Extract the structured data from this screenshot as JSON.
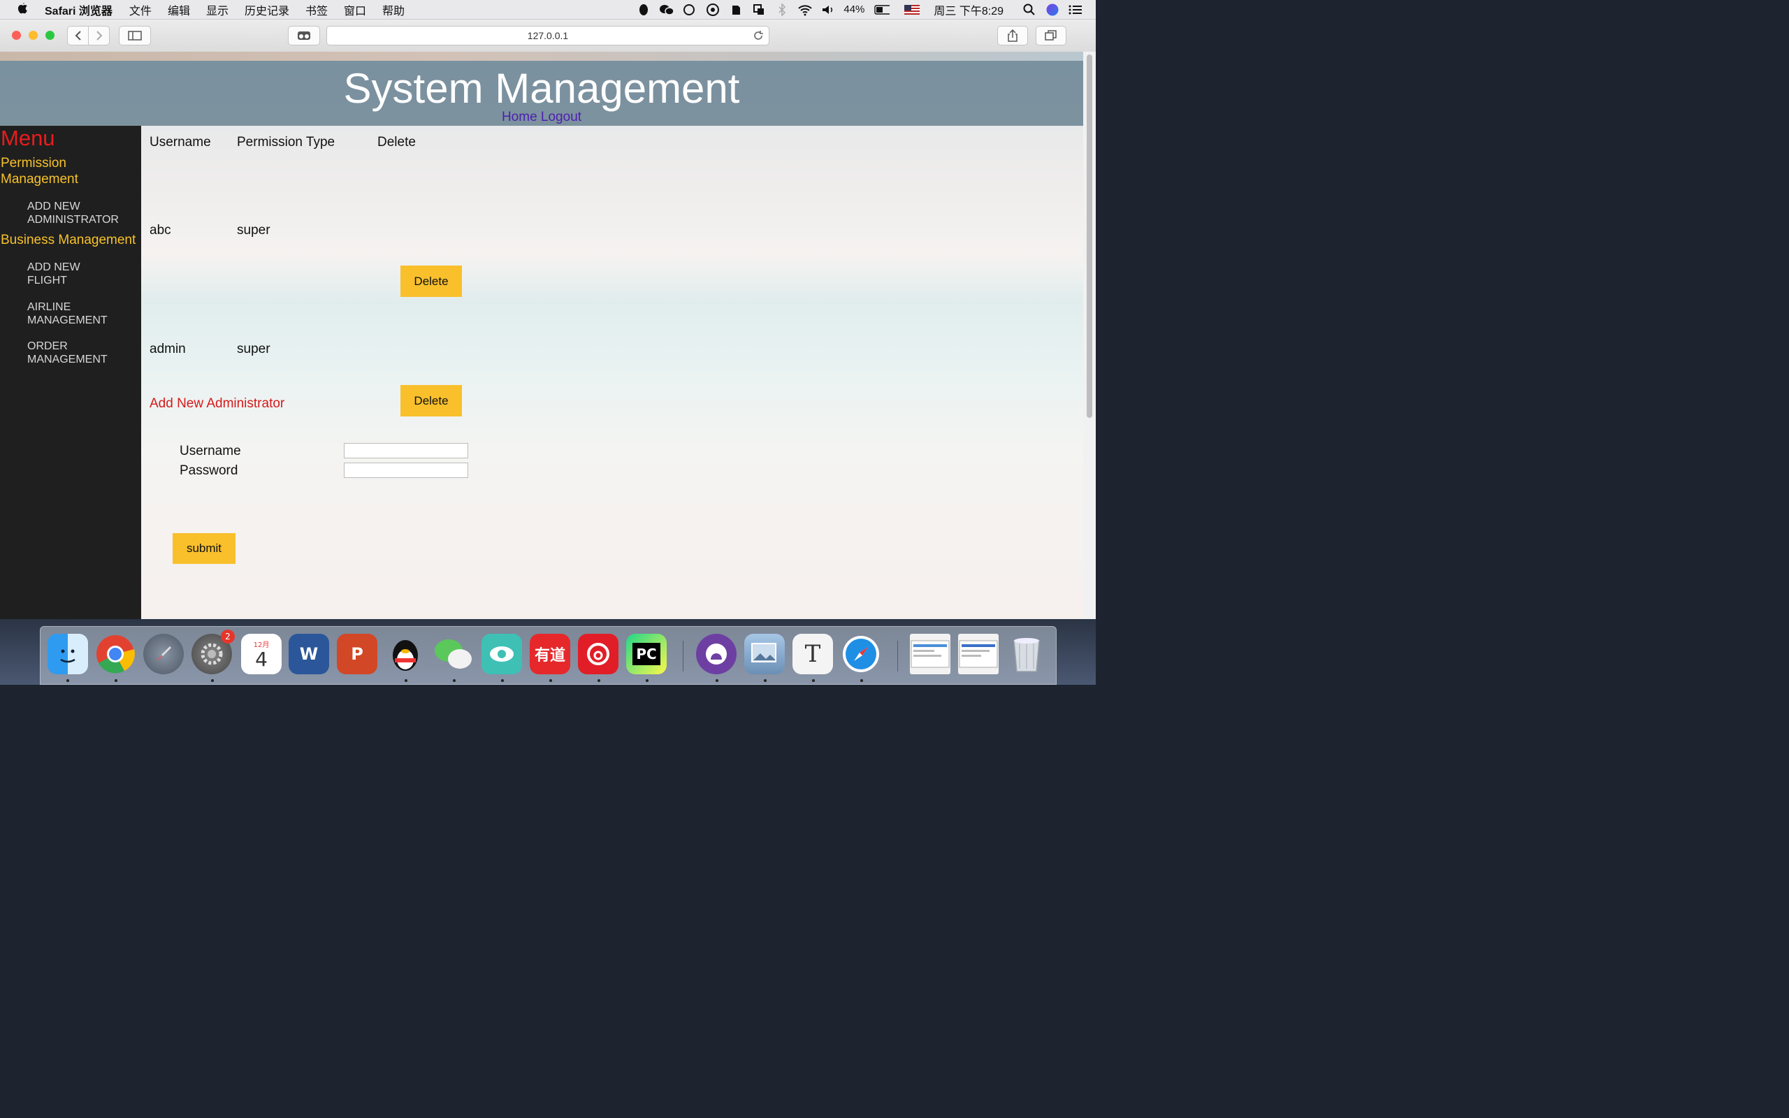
{
  "menubar": {
    "app_name": "Safari 浏览器",
    "items": [
      "文件",
      "编辑",
      "显示",
      "历史记录",
      "书签",
      "窗口",
      "帮助"
    ],
    "battery": "44%",
    "clock": "周三 下午8:29"
  },
  "browser": {
    "url": "127.0.0.1"
  },
  "page": {
    "title": "System Management",
    "links": {
      "home": "Home",
      "logout": "Logout"
    }
  },
  "sidebar": {
    "title": "Menu",
    "permission_heading": "Permission Management",
    "permission_items": [
      "Add New Administrator"
    ],
    "business_heading": "Business Management",
    "business_items": [
      "Add New Flight",
      "Airline Management",
      "Order Management"
    ]
  },
  "admin_table": {
    "headers": [
      "Username",
      "Permission Type",
      "Delete"
    ],
    "rows": [
      {
        "username": "abc",
        "permission": "super",
        "action": "Delete"
      },
      {
        "username": "admin",
        "permission": "super",
        "action": "Delete"
      }
    ]
  },
  "add_admin_form": {
    "title": "Add New Administrator",
    "username_label": "Username",
    "password_label": "Password",
    "username_value": "",
    "password_value": "",
    "submit_label": "submit"
  },
  "dock": {
    "calendar_month": "12月",
    "calendar_day": "4",
    "preferences_badge": "2"
  },
  "colors": {
    "sidebar_bg": "#1f1f1f",
    "menu_title": "#ea1c1c",
    "sidebar_heading": "#f7c22a",
    "button_bg": "#f9c02c",
    "header_link": "#4d1fb0",
    "form_title": "#d61a1a"
  }
}
